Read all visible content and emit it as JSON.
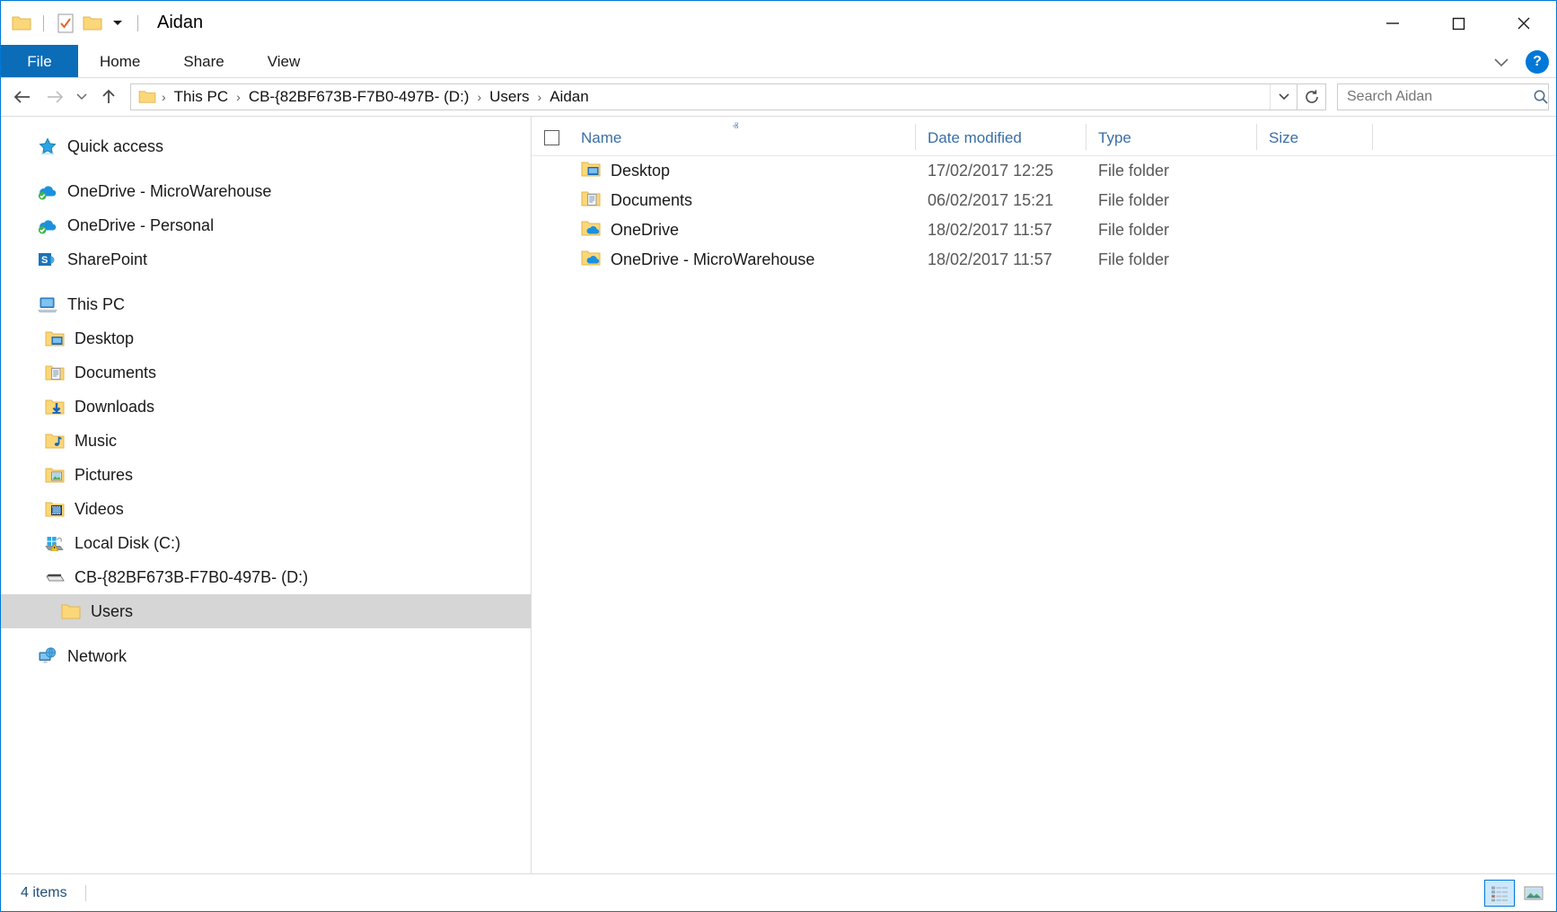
{
  "window": {
    "title": "Aidan",
    "controls": {
      "minimize": "minimize",
      "maximize": "maximize",
      "close": "close"
    },
    "quick_access_toolbar": [
      {
        "name": "folder-properties-icon",
        "label": "Properties"
      },
      {
        "name": "new-folder-icon",
        "label": "New folder"
      },
      {
        "name": "customize-qat-caret",
        "label": "Customize Quick Access Toolbar"
      }
    ]
  },
  "ribbon": {
    "tabs": [
      {
        "label": "File",
        "active": true
      },
      {
        "label": "Home",
        "active": false
      },
      {
        "label": "Share",
        "active": false
      },
      {
        "label": "View",
        "active": false
      }
    ],
    "expand_label": "⌄",
    "help_label": "?"
  },
  "address": {
    "back_label": "←",
    "forward_label": "→",
    "recent_label": "⌄",
    "up_label": "↑",
    "breadcrumb": [
      "This PC",
      "CB-{82BF673B-F7B0-497B- (D:)",
      "Users",
      "Aidan"
    ],
    "separator": "›",
    "dropdown_label": "⌄",
    "refresh_label": "↻"
  },
  "search": {
    "placeholder": "Search Aidan",
    "value": ""
  },
  "sidebar": {
    "items": [
      {
        "label": "Quick access",
        "icon": "star-icon",
        "level": 0
      },
      {
        "label": "OneDrive - MicroWarehouse",
        "icon": "onedrive-cloud-icon",
        "level": 0
      },
      {
        "label": "OneDrive - Personal",
        "icon": "onedrive-cloud-icon",
        "level": 0
      },
      {
        "label": "SharePoint",
        "icon": "sharepoint-icon",
        "level": 0
      },
      {
        "label": "This PC",
        "icon": "this-pc-icon",
        "level": 0
      },
      {
        "label": "Desktop",
        "icon": "desktop-folder-icon",
        "level": 1
      },
      {
        "label": "Documents",
        "icon": "documents-folder-icon",
        "level": 1
      },
      {
        "label": "Downloads",
        "icon": "downloads-folder-icon",
        "level": 1
      },
      {
        "label": "Music",
        "icon": "music-folder-icon",
        "level": 1
      },
      {
        "label": "Pictures",
        "icon": "pictures-folder-icon",
        "level": 1
      },
      {
        "label": "Videos",
        "icon": "videos-folder-icon",
        "level": 1
      },
      {
        "label": "Local Disk (C:)",
        "icon": "local-disk-bitlocker-icon",
        "level": 1
      },
      {
        "label": "CB-{82BF673B-F7B0-497B- (D:)",
        "icon": "drive-icon",
        "level": 1
      },
      {
        "label": "Users",
        "icon": "folder-icon",
        "level": 2,
        "selected": true
      },
      {
        "label": "Network",
        "icon": "network-icon",
        "level": 0
      }
    ]
  },
  "filelist": {
    "columns": [
      {
        "label": "Name",
        "sorted": "asc"
      },
      {
        "label": "Date modified"
      },
      {
        "label": "Type"
      },
      {
        "label": "Size"
      }
    ],
    "sort_caret": "ⱏ",
    "rows": [
      {
        "name": "Desktop",
        "icon": "desktop-folder-icon",
        "date": "17/02/2017 12:25",
        "type": "File folder",
        "size": ""
      },
      {
        "name": "Documents",
        "icon": "documents-folder-icon",
        "date": "06/02/2017 15:21",
        "type": "File folder",
        "size": ""
      },
      {
        "name": "OneDrive",
        "icon": "onedrive-folder-icon",
        "date": "18/02/2017 11:57",
        "type": "File folder",
        "size": ""
      },
      {
        "name": "OneDrive - MicroWarehouse",
        "icon": "onedrive-folder-icon",
        "date": "18/02/2017 11:57",
        "type": "File folder",
        "size": ""
      }
    ]
  },
  "status": {
    "item_count": "4 items",
    "views": [
      {
        "name": "details-view-button",
        "label": "Details view",
        "active": true
      },
      {
        "name": "large-icons-view-button",
        "label": "Large icons view",
        "active": false
      }
    ]
  },
  "colors": {
    "accent": "#0078d7",
    "file_tab": "#0b6cb8",
    "selection": "#d6d6d6",
    "header_text": "#3a6ea5",
    "folder_yellow": "#fbd779"
  }
}
